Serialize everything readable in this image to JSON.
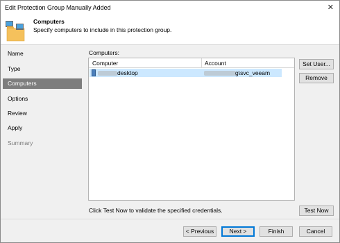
{
  "window": {
    "title": "Edit Protection Group Manually Added"
  },
  "header": {
    "title": "Computers",
    "subtitle": "Specify computers to include in this protection group."
  },
  "sidebar": {
    "items": [
      {
        "label": "Name",
        "state": "normal"
      },
      {
        "label": "Type",
        "state": "normal"
      },
      {
        "label": "Computers",
        "state": "active"
      },
      {
        "label": "Options",
        "state": "normal"
      },
      {
        "label": "Review",
        "state": "normal"
      },
      {
        "label": "Apply",
        "state": "normal"
      },
      {
        "label": "Summary",
        "state": "disabled"
      }
    ]
  },
  "computers": {
    "label": "Computers:",
    "columns": [
      "Computer",
      "Account"
    ],
    "rows": [
      {
        "computer": "desktop",
        "account": "g\\svc_veeam",
        "selected": true
      }
    ],
    "hint": "Click Test Now to validate the specified credentials."
  },
  "buttons": {
    "set_user": "Set User...",
    "remove": "Remove",
    "test_now": "Test Now",
    "previous": "< Previous",
    "next": "Next >",
    "finish": "Finish",
    "cancel": "Cancel"
  },
  "colors": {
    "selection": "#cce8ff",
    "active_step": "#7d7d7d",
    "default_button_border": "#0078d7"
  }
}
